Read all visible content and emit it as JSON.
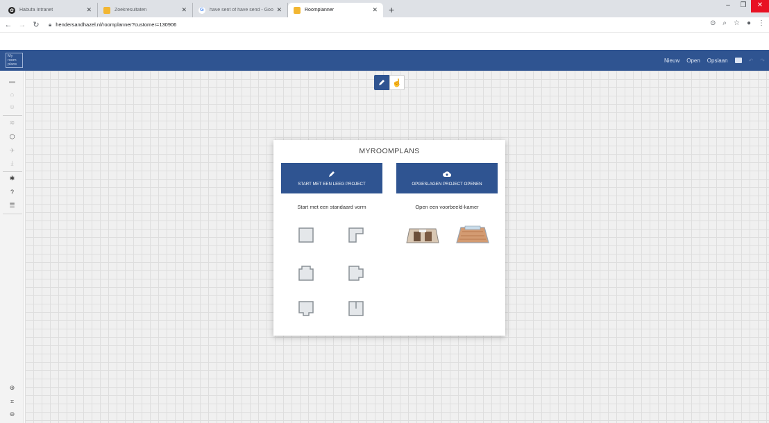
{
  "browser": {
    "tabs": [
      {
        "title": "Habufa Intranet",
        "fav_color": "#2a2a2a",
        "fav_glyph": "✿"
      },
      {
        "title": "Zoekresultaten",
        "fav_color": "#f2b632",
        "fav_glyph": ""
      },
      {
        "title": "have sent of have send - Google",
        "fav_color": "#ffffff",
        "fav_glyph": "G"
      },
      {
        "title": "Roomplanner",
        "fav_color": "#f2b632",
        "fav_glyph": ""
      }
    ],
    "new_tab": "+",
    "url": "hendersandhazel.nl/roomplanner?customer=130906"
  },
  "header": {
    "logo_lines": [
      "My",
      "room",
      "plans"
    ],
    "menu": [
      "Nieuw",
      "Open",
      "Opslaan"
    ]
  },
  "modal": {
    "title": "MYROOMPLANS",
    "start_empty": "START MET EEN LEEG PROJECT",
    "open_saved": "OPGESLAGEN PROJECT OPENEN",
    "shapes_heading": "Start met een standaard vorm",
    "examples_heading": "Open een voorbeeld-kamer"
  },
  "icons": {
    "pencil": "pencil-icon",
    "cloud_upload": "cloud-upload-icon",
    "hand": "hand-icon"
  },
  "colors": {
    "brand_blue": "#2f5491",
    "canvas": "#f0f0f0"
  }
}
